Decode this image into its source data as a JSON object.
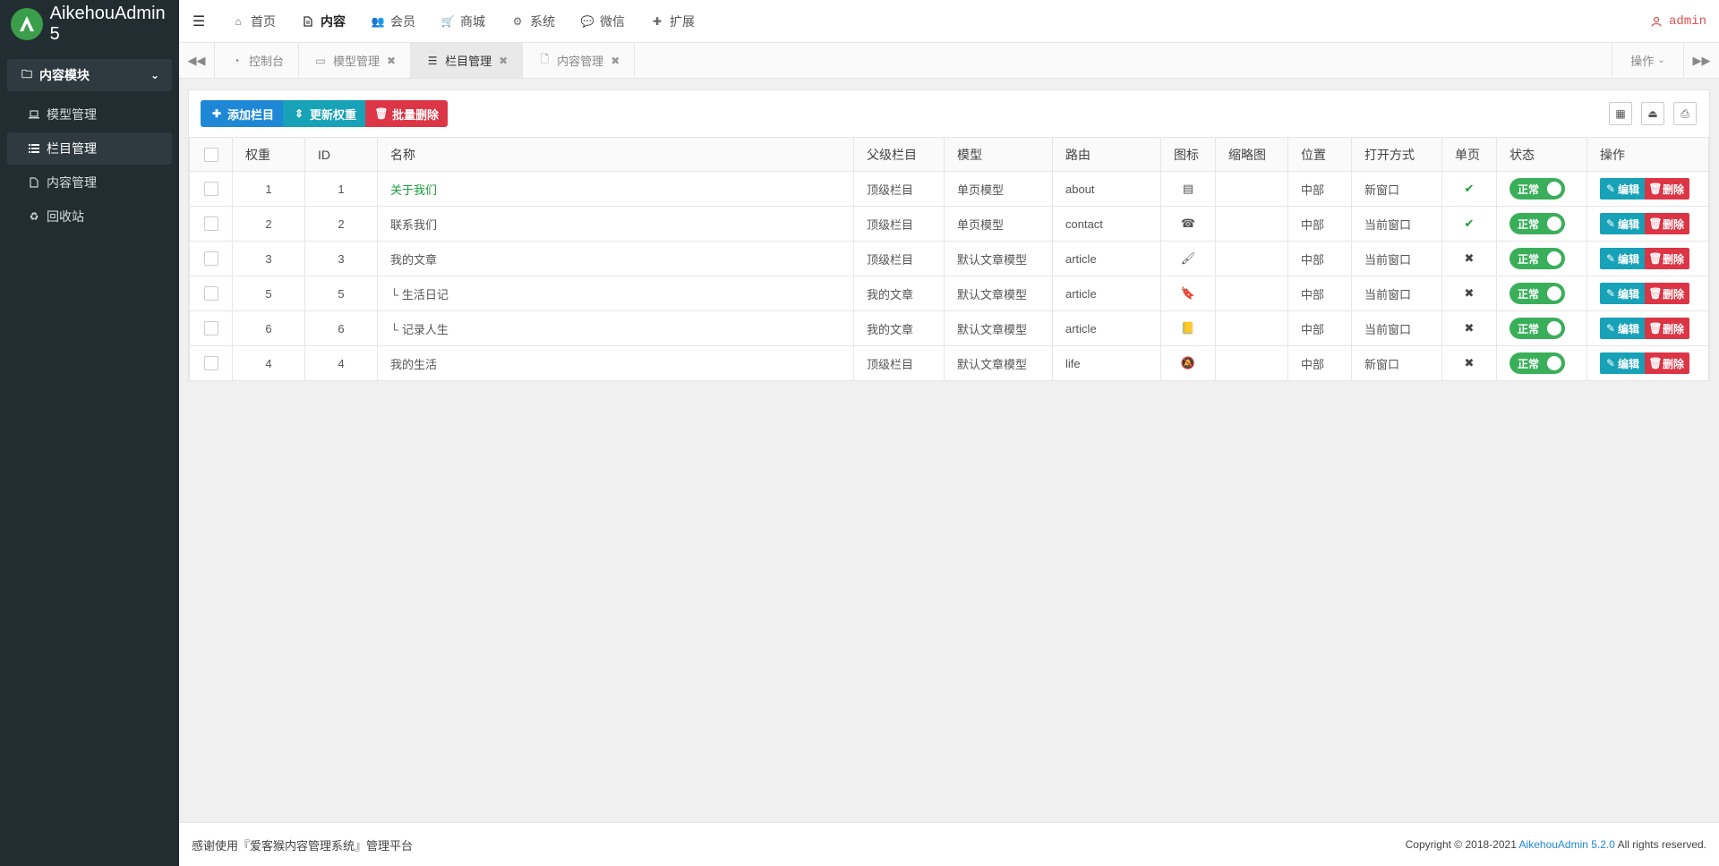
{
  "brand": {
    "name": "AikehouAdmin 5"
  },
  "sidebar": {
    "module": "内容模块",
    "items": [
      {
        "label": "模型管理",
        "icon": "laptop-icon"
      },
      {
        "label": "栏目管理",
        "icon": "list-icon",
        "active": true
      },
      {
        "label": "内容管理",
        "icon": "file-icon"
      },
      {
        "label": "回收站",
        "icon": "recycle-icon"
      }
    ]
  },
  "topnav": {
    "items": [
      {
        "label": "首页"
      },
      {
        "label": "内容"
      },
      {
        "label": "会员"
      },
      {
        "label": "商城"
      },
      {
        "label": "系统"
      },
      {
        "label": "微信"
      },
      {
        "label": "扩展"
      }
    ],
    "user": "admin"
  },
  "tabs": {
    "items": [
      {
        "label": "控制台"
      },
      {
        "label": "模型管理"
      },
      {
        "label": "栏目管理"
      },
      {
        "label": "内容管理"
      }
    ],
    "ops_label": "操作"
  },
  "toolbar": {
    "add_label": "添加栏目",
    "update_label": "更新权重",
    "delete_label": "批量删除"
  },
  "table": {
    "headers": {
      "weight": "权重",
      "id": "ID",
      "name": "名称",
      "parent": "父级栏目",
      "model": "模型",
      "route": "路由",
      "icon": "图标",
      "thumb": "缩略图",
      "position": "位置",
      "open": "打开方式",
      "single": "单页",
      "status": "状态",
      "ops": "操作"
    },
    "rows": [
      {
        "weight": "1",
        "id": "1",
        "name": "关于我们",
        "parent": "顶级栏目",
        "model": "单页模型",
        "route": "about",
        "icon": "id-card-icon",
        "position": "中部",
        "open": "新窗口",
        "single": true,
        "status": "正常"
      },
      {
        "weight": "2",
        "id": "2",
        "name": "联系我们",
        "parent": "顶级栏目",
        "model": "单页模型",
        "route": "contact",
        "icon": "phone-square-icon",
        "position": "中部",
        "open": "当前窗口",
        "single": true,
        "status": "正常"
      },
      {
        "weight": "3",
        "id": "3",
        "name": "我的文章",
        "parent": "顶级栏目",
        "model": "默认文章模型",
        "route": "article",
        "icon": "paintbrush-icon",
        "position": "中部",
        "open": "当前窗口",
        "single": false,
        "status": "正常"
      },
      {
        "weight": "5",
        "id": "5",
        "name": "└ 生活日记",
        "parent": "我的文章",
        "model": "默认文章模型",
        "route": "article",
        "icon": "bookmark-icon",
        "position": "中部",
        "open": "当前窗口",
        "single": false,
        "status": "正常"
      },
      {
        "weight": "6",
        "id": "6",
        "name": "└ 记录人生",
        "parent": "我的文章",
        "model": "默认文章模型",
        "route": "article",
        "icon": "book-icon",
        "position": "中部",
        "open": "当前窗口",
        "single": false,
        "status": "正常"
      },
      {
        "weight": "4",
        "id": "4",
        "name": "我的生活",
        "parent": "顶级栏目",
        "model": "默认文章模型",
        "route": "life",
        "icon": "bell-slash-icon",
        "position": "中部",
        "open": "新窗口",
        "single": false,
        "status": "正常"
      }
    ],
    "edit_label": "编辑",
    "delete_label": "删除"
  },
  "footer": {
    "left": "感谢使用『爱客猴内容管理系统』管理平台",
    "copyright_prefix": "Copyright © 2018-2021 ",
    "copyright_link": "AikehouAdmin 5.2.0",
    "copyright_suffix": " All rights reserved."
  },
  "colors": {
    "sidebar": "#222d32",
    "primary": "#1e88d6",
    "info": "#17a2b8",
    "danger": "#dc3545",
    "success": "#3aaf5a"
  }
}
